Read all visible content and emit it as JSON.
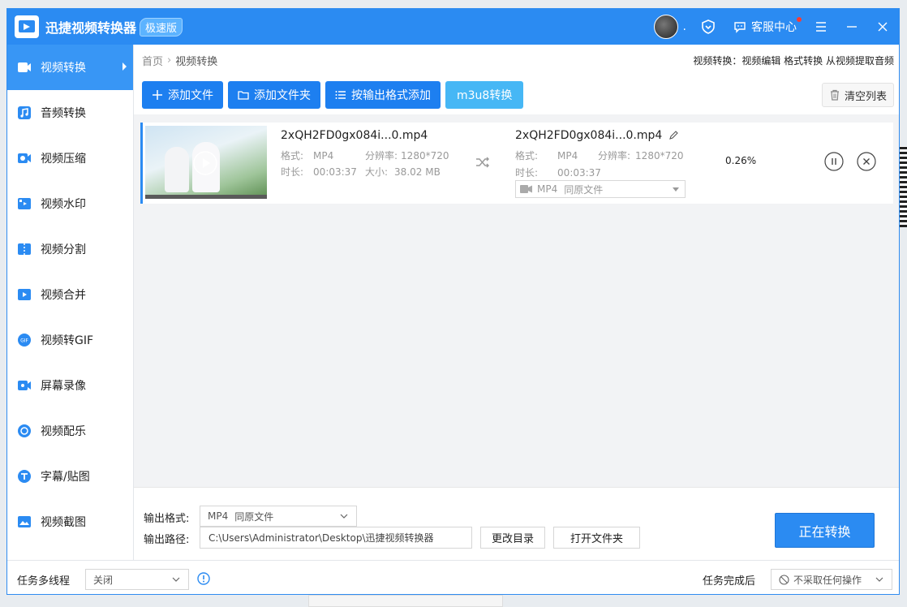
{
  "window": {
    "app_title": "迅捷视频转换器",
    "badge": "极速版",
    "customer_service": "客服中心",
    "avatar_text": "."
  },
  "sidebar": {
    "items": [
      {
        "label": "视频转换",
        "icon": "video-convert-icon",
        "active": true
      },
      {
        "label": "音频转换",
        "icon": "audio-convert-icon"
      },
      {
        "label": "视频压缩",
        "icon": "video-compress-icon"
      },
      {
        "label": "视频水印",
        "icon": "video-watermark-icon"
      },
      {
        "label": "视频分割",
        "icon": "video-split-icon"
      },
      {
        "label": "视频合并",
        "icon": "video-merge-icon"
      },
      {
        "label": "视频转GIF",
        "icon": "gif-icon"
      },
      {
        "label": "屏幕录像",
        "icon": "screen-record-icon"
      },
      {
        "label": "视频配乐",
        "icon": "music-icon"
      },
      {
        "label": "字幕/贴图",
        "icon": "subtitle-icon"
      },
      {
        "label": "视频截图",
        "icon": "screenshot-icon"
      }
    ]
  },
  "breadcrumb": {
    "home": "首页",
    "current": "视频转换",
    "quick_links": "视频转换：视频编辑 格式转换 从视频提取音频"
  },
  "toolbar": {
    "add_file": "添加文件",
    "add_folder": "添加文件夹",
    "add_by_format": "按输出格式添加",
    "m3u8": "m3u8转换",
    "clear_list": "清空列表"
  },
  "file": {
    "source": {
      "name": "2xQH2FD0gx084i...0.mp4",
      "format_label": "格式:",
      "format": "MP4",
      "resolution_label": "分辨率:",
      "resolution": "1280*720",
      "duration_label": "时长:",
      "duration": "00:03:37",
      "size_label": "大小:",
      "size": "38.02 MB"
    },
    "target": {
      "name": "2xQH2FD0gx084i...0.mp4",
      "format_label": "格式:",
      "format": "MP4",
      "resolution_label": "分辨率:",
      "resolution": "1280*720",
      "duration_label": "时长:",
      "duration": "00:03:37",
      "output_format": "MP4",
      "output_quality": "同原文件"
    },
    "progress": "0.26%"
  },
  "settings": {
    "output_format_label": "输出格式:",
    "output_format_value": "MP4",
    "output_format_quality": "同原文件",
    "output_path_label": "输出路径:",
    "output_path": "C:\\Users\\Administrator\\Desktop\\迅捷视频转换器",
    "change_dir": "更改目录",
    "open_folder": "打开文件夹",
    "start": "正在转换"
  },
  "bottom": {
    "multithread_label": "任务多线程",
    "multithread_value": "关闭",
    "after_task_label": "任务完成后",
    "after_task_value": "不采取任何操作"
  },
  "colors": {
    "brand": "#2b8bf2",
    "active_side": "#3896f5",
    "button": "#1d7ff0",
    "m3u8_button": "#46b7f5"
  }
}
